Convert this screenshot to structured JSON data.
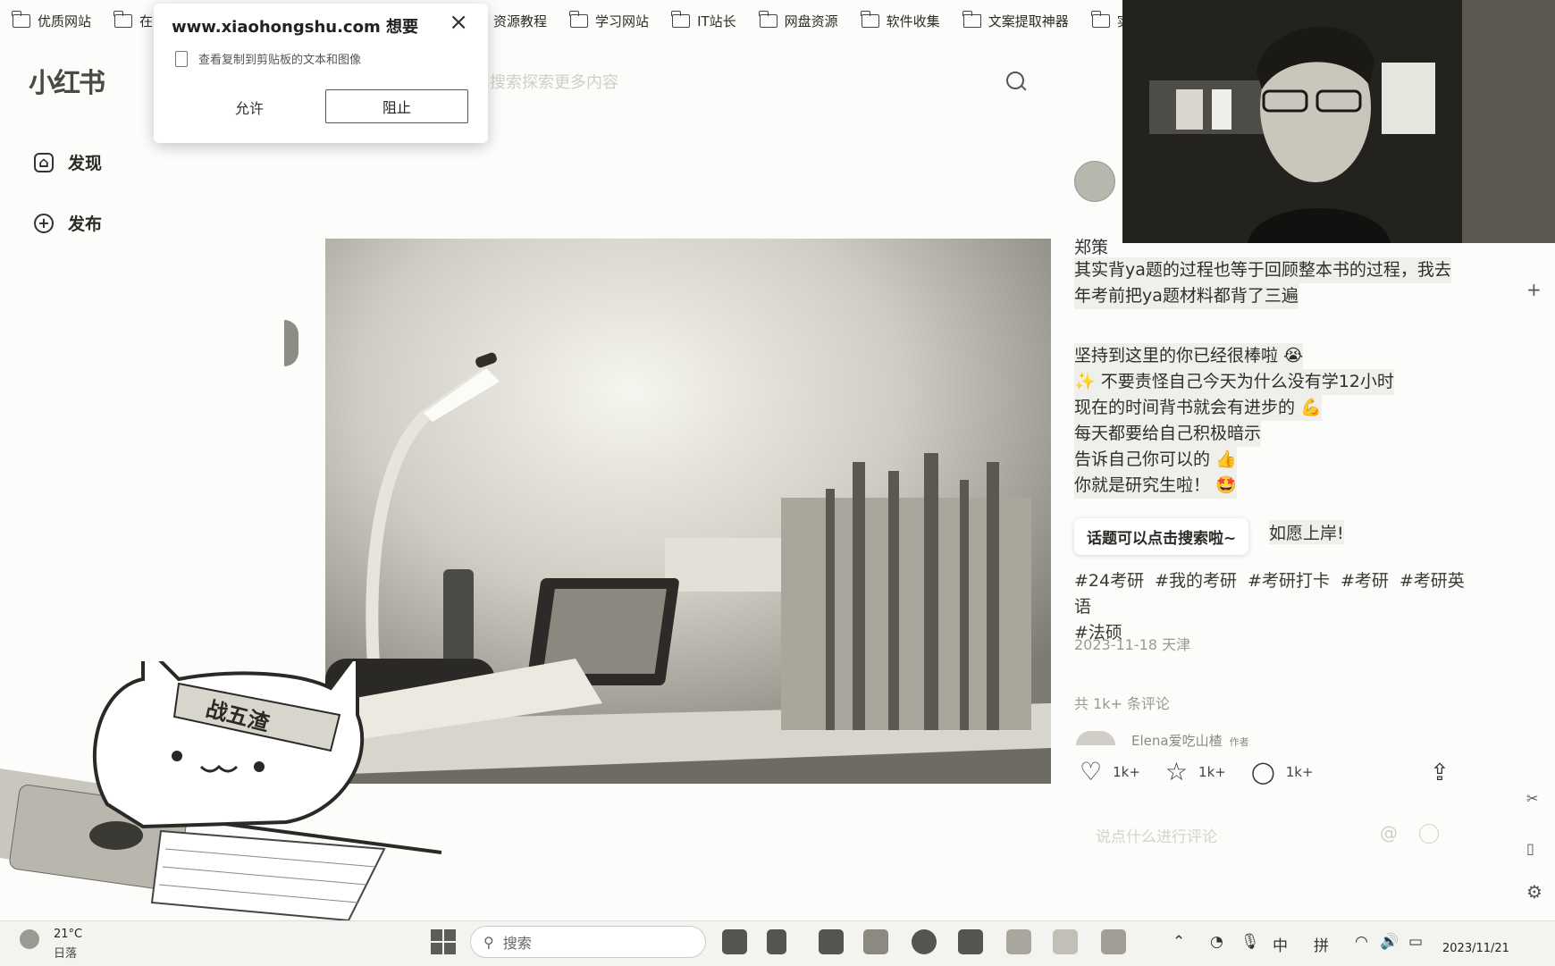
{
  "bookmarks": [
    {
      "label": "优质网站"
    },
    {
      "label": "在线"
    },
    {
      "label": "资源教程"
    },
    {
      "label": "学习网站"
    },
    {
      "label": "IT站长"
    },
    {
      "label": "网盘资源"
    },
    {
      "label": "软件收集"
    },
    {
      "label": "文案提取神器"
    },
    {
      "label": "实用"
    }
  ],
  "permission_popup": {
    "title": "www.xiaohongshu.com 想要",
    "request": "查看复制到剪贴板的文本和图像",
    "allow_label": "允许",
    "block_label": "阻止"
  },
  "nav": {
    "logo": "小红书",
    "items": [
      {
        "label": "发现",
        "icon": "home-icon"
      },
      {
        "label": "发布",
        "icon": "plus-icon"
      }
    ],
    "search_placeholder": "搜索探索更多内容"
  },
  "post": {
    "author": "郑策",
    "lines": [
      "其实背ya题的过程也等于回顾整本书的过程，我去",
      "年考前把ya题材料都背了三遍",
      "",
      "坚持到这里的你已经很棒啦 😭",
      "✨ 不要责怪自己今天为什么没有学12小时",
      "现在的时间背书就会有进步的 💪",
      "每天都要给自己积极暗示",
      "告诉自己你可以的 👍",
      "你就是研究生啦！ 🤩"
    ],
    "tooltip": "话题可以点击搜索啦~",
    "tooltip_tail": "如愿上岸!",
    "tags": [
      "#24考研",
      "#我的考研",
      "#考研打卡",
      "#考研",
      "#考研英语",
      "#法硕"
    ],
    "date": "2023-11-18 天津",
    "comment_count": "共 1k+ 条评论",
    "first_commenter": "Elena爱吃山楂",
    "first_commenter_tag": "作者",
    "likes": "1k+",
    "collects": "1k+",
    "comments": "1k+",
    "comment_placeholder": "说点什么进行评论"
  },
  "sticker": {
    "headband_text": "战五渣"
  },
  "taskbar": {
    "temperature": "21°C",
    "weather": "日落",
    "search_label": "搜索",
    "ime_lang": "中",
    "ime_mode": "拼",
    "clock": "2023/11/21"
  },
  "colors": {
    "background": "#fcfcfa",
    "text": "#2a2a26",
    "highlight": "#efefeb"
  }
}
